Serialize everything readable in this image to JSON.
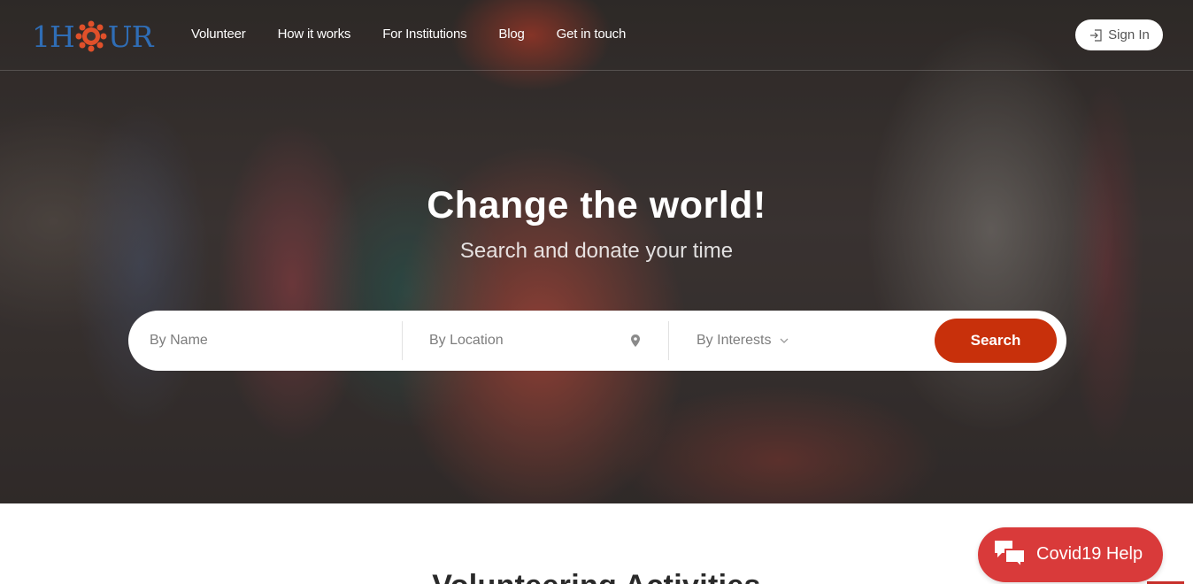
{
  "brand": {
    "logo_text_left": "1H",
    "logo_text_right": "UR",
    "logo_color": "#2f6db5",
    "gear_color": "#e0502a"
  },
  "nav": {
    "links": [
      {
        "label": "Volunteer"
      },
      {
        "label": "How it works"
      },
      {
        "label": "For Institutions"
      },
      {
        "label": "Blog"
      },
      {
        "label": "Get in touch"
      }
    ],
    "sign_in_label": "Sign In"
  },
  "hero": {
    "title": "Change the world!",
    "subtitle": "Search and donate your time"
  },
  "search": {
    "name_placeholder": "By Name",
    "location_placeholder": "By Location",
    "interests_label": "By Interests",
    "button_label": "Search",
    "button_color": "#c8300b"
  },
  "section": {
    "title": "Volunteering Activities"
  },
  "covid_button": {
    "label": "Covid19 Help",
    "color": "#d93a3a"
  },
  "icons": {
    "sign_in": "sign-in-icon",
    "location": "map-pin-icon",
    "dropdown": "chevron-down-icon",
    "chat": "chat-bubbles-icon"
  }
}
